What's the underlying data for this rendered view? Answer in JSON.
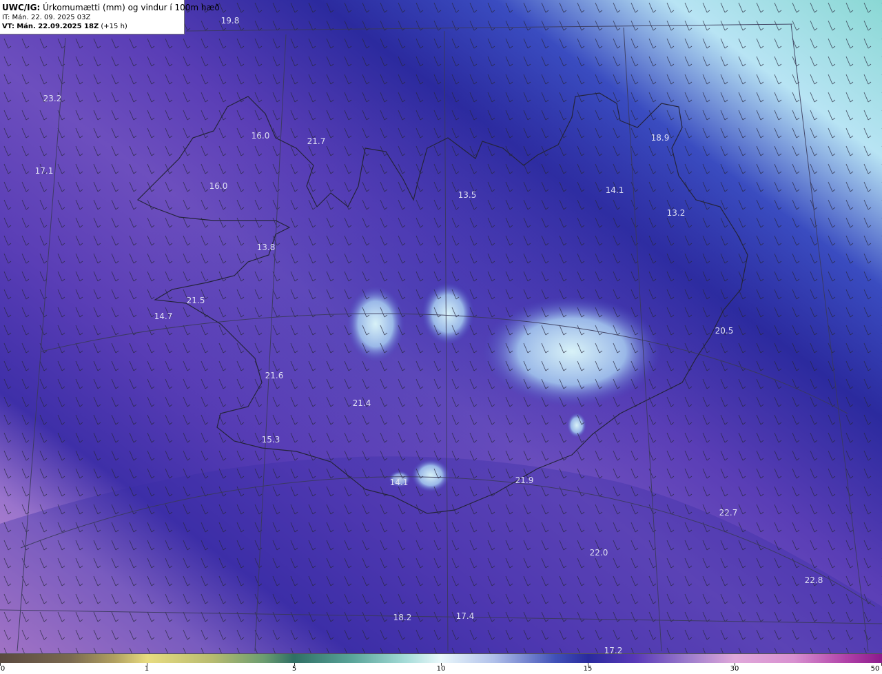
{
  "header": {
    "product": "UWC/IG:",
    "title": "Úrkomumætti (mm) og vindur í 100m hæð",
    "init_time": "IT: Mán. 22. 09. 2025 03Z",
    "valid_label": "VT:",
    "valid_time": "Mán. 22.09.2025 18Z",
    "lead_time": "(+15 h)"
  },
  "map": {
    "region": "Iceland",
    "variable": "precipitable water (mm)",
    "wind_level": "100m",
    "colors": {
      "background_high": "#e0a8da",
      "background_mid": "#5a3eb6",
      "background_low": "#2a2a9e",
      "highland_light": "#cfe8f5",
      "land_outline": "#2a2a40",
      "graticule": "#3a3a5a"
    },
    "labels": [
      {
        "value": "19.8"
      },
      {
        "value": "23.2"
      },
      {
        "value": "17.1"
      },
      {
        "value": "16.0"
      },
      {
        "value": "21.7"
      },
      {
        "value": "16.0"
      },
      {
        "value": "13.8"
      },
      {
        "value": "21.5"
      },
      {
        "value": "14.7"
      },
      {
        "value": "21.6"
      },
      {
        "value": "21.4"
      },
      {
        "value": "15.3"
      },
      {
        "value": "13.5"
      },
      {
        "value": "14.1"
      },
      {
        "value": "18.9"
      },
      {
        "value": "13.2"
      },
      {
        "value": "20.5"
      },
      {
        "value": "21.9"
      },
      {
        "value": "14.1"
      },
      {
        "value": "22.7"
      },
      {
        "value": "22.0"
      },
      {
        "value": "22.8"
      },
      {
        "value": "18.2"
      },
      {
        "value": "17.4"
      },
      {
        "value": "17.2"
      }
    ]
  },
  "colorbar": {
    "ticks": [
      "0",
      "1",
      "5",
      "10",
      "15",
      "30",
      "50"
    ]
  }
}
